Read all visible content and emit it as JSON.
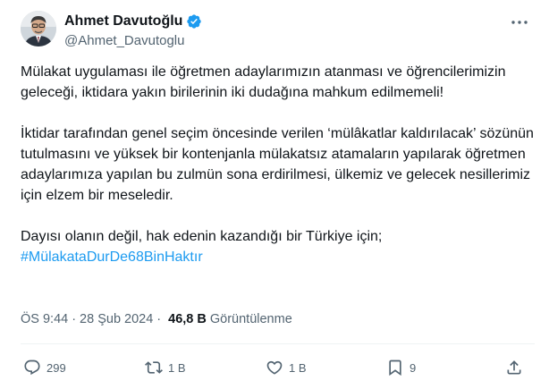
{
  "author": {
    "name": "Ahmet Davutoğlu",
    "handle": "@Ahmet_Davutoglu",
    "verified": true
  },
  "tweet": {
    "paragraph1": "Mülakat uygulaması ile öğretmen adaylarımızın atanması ve öğrencilerimizin geleceği, iktidara yakın birilerinin iki dudağına mahkum edilmemeli!",
    "paragraph2": "İktidar tarafından genel seçim öncesinde verilen ‘mülâkatlar kaldırılacak’ sözünün tutulmasını ve yüksek bir kontenjanla mülakatsız atamaların yapılarak öğretmen adaylarımıza yapılan bu zulmün sona erdirilmesi, ülkemiz ve gelecek nesillerimiz için elzem bir meseledir.",
    "paragraph3": "Dayısı olanın değil, hak edenin kazandığı bir Türkiye için;",
    "hashtag": "#MülakataDurDe68BinHaktır"
  },
  "meta": {
    "time": "ÖS 9:44",
    "separator": "·",
    "date": "28 Şub 2024",
    "views": "46,8 B",
    "views_label": "Görüntülenme"
  },
  "actions": {
    "replies": "299",
    "retweets": "1 B",
    "likes": "1 B",
    "bookmarks": "9"
  },
  "colors": {
    "accent": "#1d9bf0",
    "text": "#0f1419",
    "secondary": "#536471",
    "divider": "#eff3f4"
  },
  "icons": [
    "more-icon",
    "verified-icon",
    "reply-icon",
    "retweet-icon",
    "like-icon",
    "bookmark-icon",
    "share-icon"
  ]
}
